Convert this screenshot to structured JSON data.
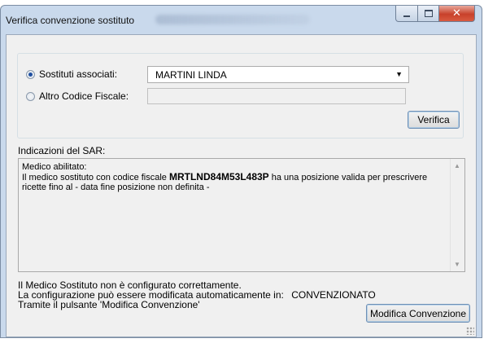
{
  "window": {
    "title": "Verifica convenzione sostituto",
    "controls": {
      "minimize_icon": "minimize-icon",
      "maximize_icon": "maximize-icon",
      "close_icon": "close-icon",
      "close_glyph": "✕"
    }
  },
  "selection": {
    "radio_sostituti": {
      "label": "Sostituti associati:",
      "checked": true
    },
    "combo_sostituti": {
      "value": "MARTINI LINDA",
      "arrow": "▼"
    },
    "radio_altro_cf": {
      "label": "Altro Codice Fiscale:",
      "checked": false
    },
    "cf_input": {
      "value": "",
      "placeholder": ""
    },
    "verify_button": "Verifica"
  },
  "sar": {
    "label": "Indicazioni del SAR:",
    "line1": "Medico abilitato:",
    "line2_prefix": "Il medico sostituto con codice fiscale",
    "codice_fiscale": "MRTLND84M53L483P",
    "line2_suffix": "ha una posizione valida per prescrivere",
    "line3": "ricette fino al  - data fine posizione non definita -",
    "scroll_up": "▲",
    "scroll_down": "▼"
  },
  "footer": {
    "line1": "Il Medico Sostituto non è configurato correttamente.",
    "line2_prefix": "La configurazione può essere modificata automaticamente in:",
    "line2_value": "CONVENZIONATO",
    "line3": "Tramite il pulsante 'Modifica Convenzione'",
    "modify_button": "Modifica Convenzione"
  },
  "colors": {
    "frame": "#c9d9ec",
    "client": "#f0f0f0",
    "close_button": "#c8412b",
    "radio_dot": "#1f4fa0"
  }
}
